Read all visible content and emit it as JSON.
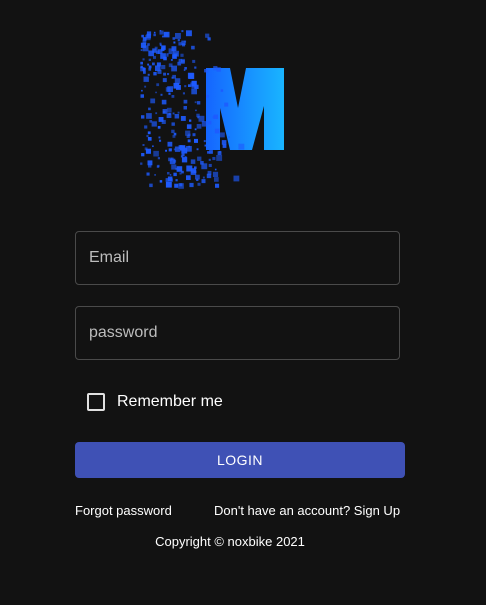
{
  "logo": {
    "letter": "M",
    "gradient_start": "#1565ff",
    "gradient_end": "#19b5ff",
    "particle_color": "#1e5bff"
  },
  "form": {
    "email_placeholder": "Email",
    "password_placeholder": "password",
    "remember_label": "Remember me",
    "remember_checked": false,
    "login_label": "LOGIN",
    "accent_color": "#3f51b5"
  },
  "links": {
    "forgot_password": "Forgot password",
    "sign_up": "Don't have an account? Sign Up"
  },
  "footer": {
    "copyright": "Copyright © noxbike 2021"
  }
}
